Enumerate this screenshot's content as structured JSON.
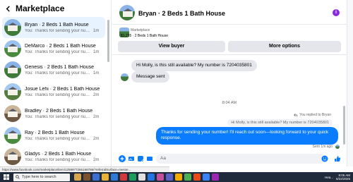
{
  "left_panel": {
    "title": "Marketplace",
    "conversations": [
      {
        "name": "Bryan · 2 Beds 1 Bath House",
        "snippet": "You: Thanks for sending your numb...",
        "time": "1m",
        "active": true
      },
      {
        "name": "DeMarco · 2 Beds 1 Bath House",
        "snippet": "You: Thanks for sending your numb...",
        "time": "1m",
        "active": false
      },
      {
        "name": "Genesis · 2 Beds 1 Bath House",
        "snippet": "You: Thanks for sending your numb...",
        "time": "1m",
        "active": false
      },
      {
        "name": "Josue Lehi · 2 Beds 1 Bath House",
        "snippet": "You: Thanks for sending your numb...",
        "time": "2m",
        "active": false
      },
      {
        "name": "Bradley · 2 Beds 1 Bath House",
        "snippet": "You: Thanks for sending your numb...",
        "time": "2m",
        "active": false
      },
      {
        "name": "Ray · 2 Beds 1 Bath House",
        "snippet": "You: Thanks for sending your numb...",
        "time": "2m",
        "active": false
      },
      {
        "name": "Gladys · 2 Beds 1 Bath House",
        "snippet": "You: Thanks for sending your numb...",
        "time": "2m",
        "active": false
      }
    ]
  },
  "chat": {
    "title": "Bryan · 2 Beds 1 Bath House",
    "listing_label": "Marketplace",
    "listing_price": "$1,235 · 2 Beds 1 Bath House",
    "view_buyer": "View buyer",
    "more_options": "More options",
    "msg_in_1": "Hi Molly, is this still available? My number is 7204035801",
    "msg_in_2": "Message sent",
    "timestamp": "8:04 AM",
    "replied_label": "You replied to Bryan",
    "quoted": "Hi Molly, is this still available? My number is 7204035801",
    "msg_out": "Thanks for sending your number! I'll reach out soon—looking forward to your quick response.",
    "sent_time": "Sent 1m ago",
    "composer_placeholder": "Aa"
  },
  "status_url": "https://www.facebook.com/marketplace/item/1259977265168786/?referralSurface=messe...",
  "taskbar": {
    "search_placeholder": "Type here to search",
    "tray_label": "Hea...",
    "time": "8:05 AM",
    "date": "5/22/2025"
  },
  "colors": {
    "accent": "#0a7cff",
    "active_row": "#e7f3ff",
    "info_purple": "#8a2be2"
  }
}
